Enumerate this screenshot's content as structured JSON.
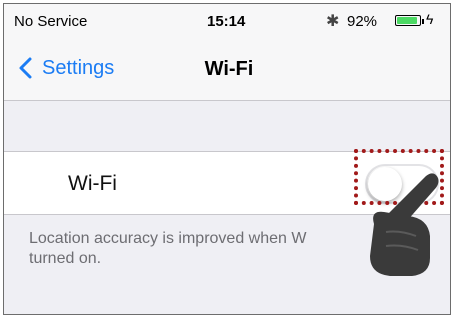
{
  "status_bar": {
    "carrier": "No Service",
    "time": "15:14",
    "battery_percent": "92%",
    "battery_level": 0.92,
    "icons": [
      "bluetooth-icon",
      "battery-icon",
      "charging-icon"
    ]
  },
  "nav": {
    "back_label": "Settings",
    "title": "Wi-Fi"
  },
  "wifi_cell": {
    "label": "Wi-Fi",
    "toggle_state": "off"
  },
  "footer": {
    "text": "Location accuracy is improved when W\nturned on."
  },
  "colors": {
    "accent": "#1b7cf4",
    "highlight": "#a11a1a",
    "battery": "#4cd964",
    "background": "#efeff4"
  }
}
